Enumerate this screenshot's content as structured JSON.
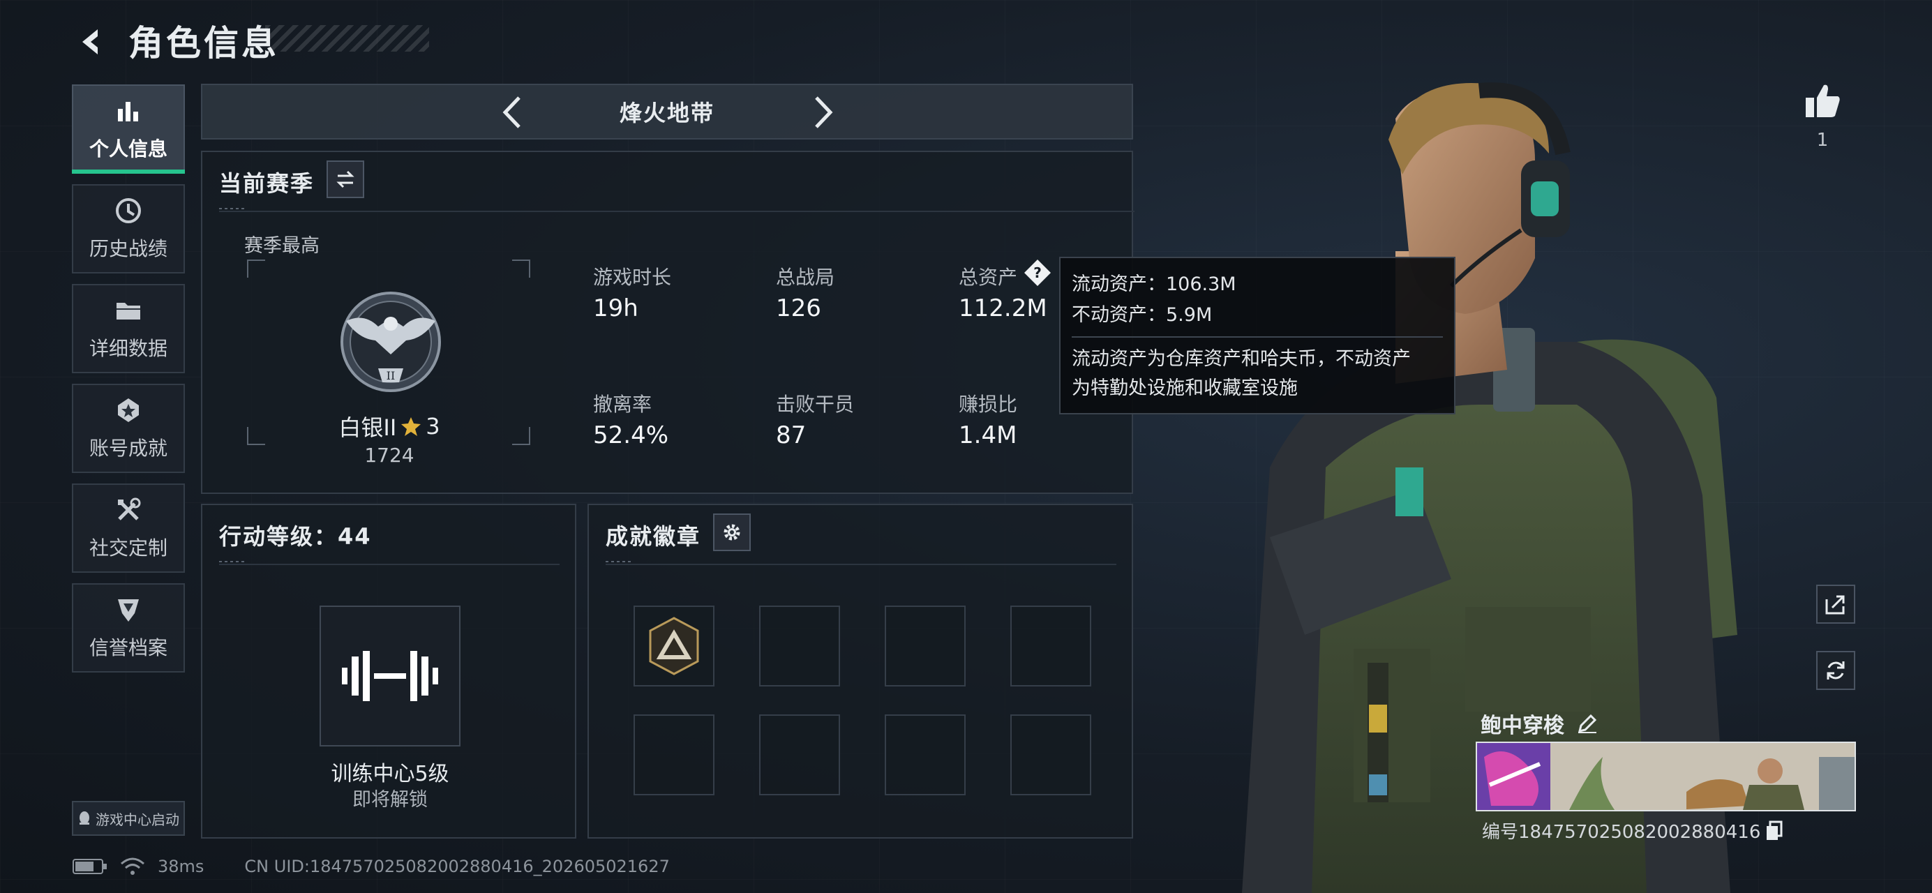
{
  "header": {
    "title": "角色信息",
    "back_icon": "back-arrow-icon"
  },
  "sidebar": {
    "items": [
      {
        "label": "个人信息",
        "icon": "bar-chart-icon",
        "active": true
      },
      {
        "label": "历史战绩",
        "icon": "history-clock-icon",
        "active": false
      },
      {
        "label": "详细数据",
        "icon": "folder-icon",
        "active": false
      },
      {
        "label": "账号成就",
        "icon": "medal-icon",
        "active": false
      },
      {
        "label": "社交定制",
        "icon": "tools-icon",
        "active": false
      },
      {
        "label": "信誉档案",
        "icon": "shield-icon",
        "active": false
      }
    ],
    "launch_tag": "游戏中心启动"
  },
  "mode_bar": {
    "name": "烽火地带"
  },
  "season_panel": {
    "title": "当前赛季",
    "best_label": "赛季最高",
    "rank_name": "白银II",
    "rank_stars": "3",
    "rank_score": "1724",
    "rank_roman": "II",
    "stats": [
      {
        "label": "游戏时长",
        "value": "19h"
      },
      {
        "label": "总战局",
        "value": "126"
      },
      {
        "label": "总资产",
        "value": "112.2M"
      },
      {
        "label": "撤离率",
        "value": "52.4%"
      },
      {
        "label": "击败干员",
        "value": "87"
      },
      {
        "label": "赚损比",
        "value": "1.4M"
      }
    ]
  },
  "tooltip": {
    "liquid": "流动资产：106.3M",
    "fixed": "不动资产：5.9M",
    "desc_line1": "流动资产为仓库资产和哈夫币，不动资产",
    "desc_line2": "为特勤处设施和收藏室设施"
  },
  "level_panel": {
    "title": "行动等级：44",
    "unlock_name": "训练中心5级",
    "unlock_status": "即将解锁"
  },
  "achievements_panel": {
    "title": "成就徽章"
  },
  "profile": {
    "likes": "1",
    "card_name": "鲍中穿梭",
    "card_id": "编号1847570250820028804​16"
  },
  "footer": {
    "ping": "38ms",
    "uid": "CN UID:18475702508200288041​6_202605021627"
  },
  "colors": {
    "accent": "#26c48e",
    "gold_star": "#e2b23a"
  }
}
